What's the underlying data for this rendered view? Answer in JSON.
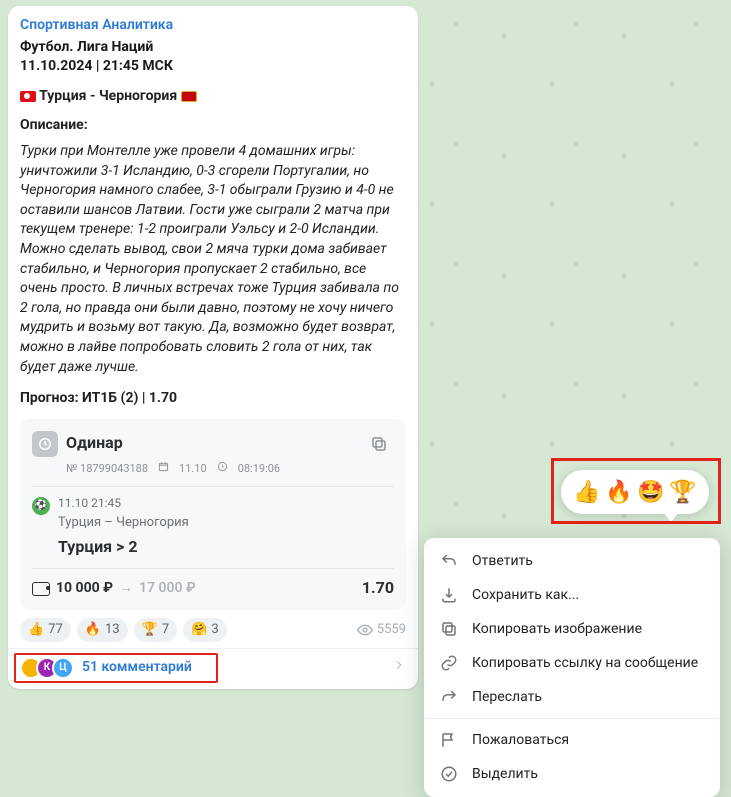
{
  "channel": {
    "name": "Спортивная Аналитика"
  },
  "header": {
    "league": "Футбол. Лига Наций",
    "datetime": "11.10.2024 | 21:45 МСК",
    "match": "Турция - Черногория"
  },
  "description": {
    "label": "Описание:",
    "text": "Турки при Монтелле уже провели 4 домашних игры: уничтожили 3-1 Исландию, 0-3 сгорели Португалии, но Черногория намного слабее, 3-1 обыграли Грузию и 4-0 не оставили шансов Латвии. Гости уже сыграли 2 матча при текущем тренере: 1-2 проиграли Уэльсу и 2-0 Исландии. Можно сделать вывод, свои 2 мяча турки дома забивает стабильно, и Черногория пропускает 2 стабильно, все очень просто. В личных встречах тоже Турция забивала по 2 гола, но правда они были давно, поэтому не хочу ничего мудрить и возьму вот такую. Да, возможно будет возврат, можно в лайве попробовать словить 2 гола от них, так будет даже лучше."
  },
  "prognoz": {
    "label": "Прогноз: ИТ1Б (2) | 1.70"
  },
  "bet_card": {
    "type": "Одинар",
    "id": "№ 18799043188",
    "date": "11.10",
    "time": "08:19:06",
    "match_dt": "11.10  21:45",
    "teams": "Турция – Черногория",
    "pick": "Турция > 2",
    "stake": "10 000 ₽",
    "win": "17 000 ₽",
    "odds": "1.70"
  },
  "reactions": [
    {
      "emoji": "👍",
      "count": "77"
    },
    {
      "emoji": "🔥",
      "count": "13"
    },
    {
      "emoji": "🏆",
      "count": "7"
    },
    {
      "emoji": "🤗",
      "count": "3"
    }
  ],
  "views": "5559",
  "comments": {
    "text": "51 комментарий"
  },
  "reaction_bubble": [
    "👍",
    "🔥",
    "🤩",
    "🏆"
  ],
  "context_menu": {
    "reply": "Ответить",
    "save_as": "Сохранить как...",
    "copy_image": "Копировать изображение",
    "copy_link": "Копировать ссылку на сообщение",
    "forward": "Переслать",
    "report": "Пожаловаться",
    "select": "Выделить"
  }
}
